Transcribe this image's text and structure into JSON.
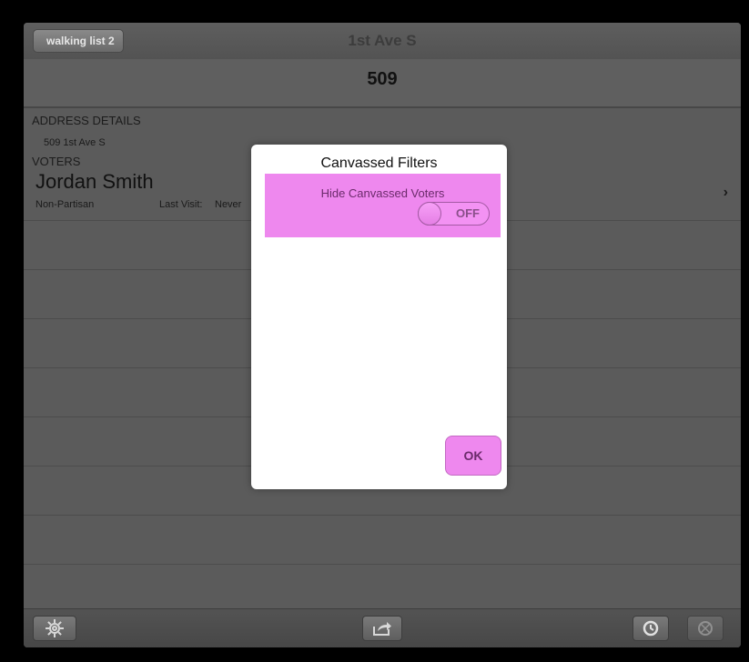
{
  "navbar": {
    "back_label": "walking list 2",
    "title": "1st Ave S"
  },
  "house": {
    "number": "509"
  },
  "address": {
    "section_title": "ADDRESS DETAILS",
    "line": "509  1st Ave S"
  },
  "voters": {
    "section_title": "VOTERS",
    "items": [
      {
        "name": "Jordan Smith",
        "party": "Non-Partisan",
        "last_visit_label": "Last Visit:",
        "last_visit": "Never"
      }
    ]
  },
  "toolbar": {
    "icons": [
      "gear-icon",
      "share-icon",
      "history-icon",
      "map-icon"
    ]
  },
  "modal": {
    "title": "Canvassed Filters",
    "filter_label": "Hide Canvassed Voters",
    "toggle_state": "OFF",
    "ok_label": "OK",
    "accent_color": "#ee88ee"
  }
}
